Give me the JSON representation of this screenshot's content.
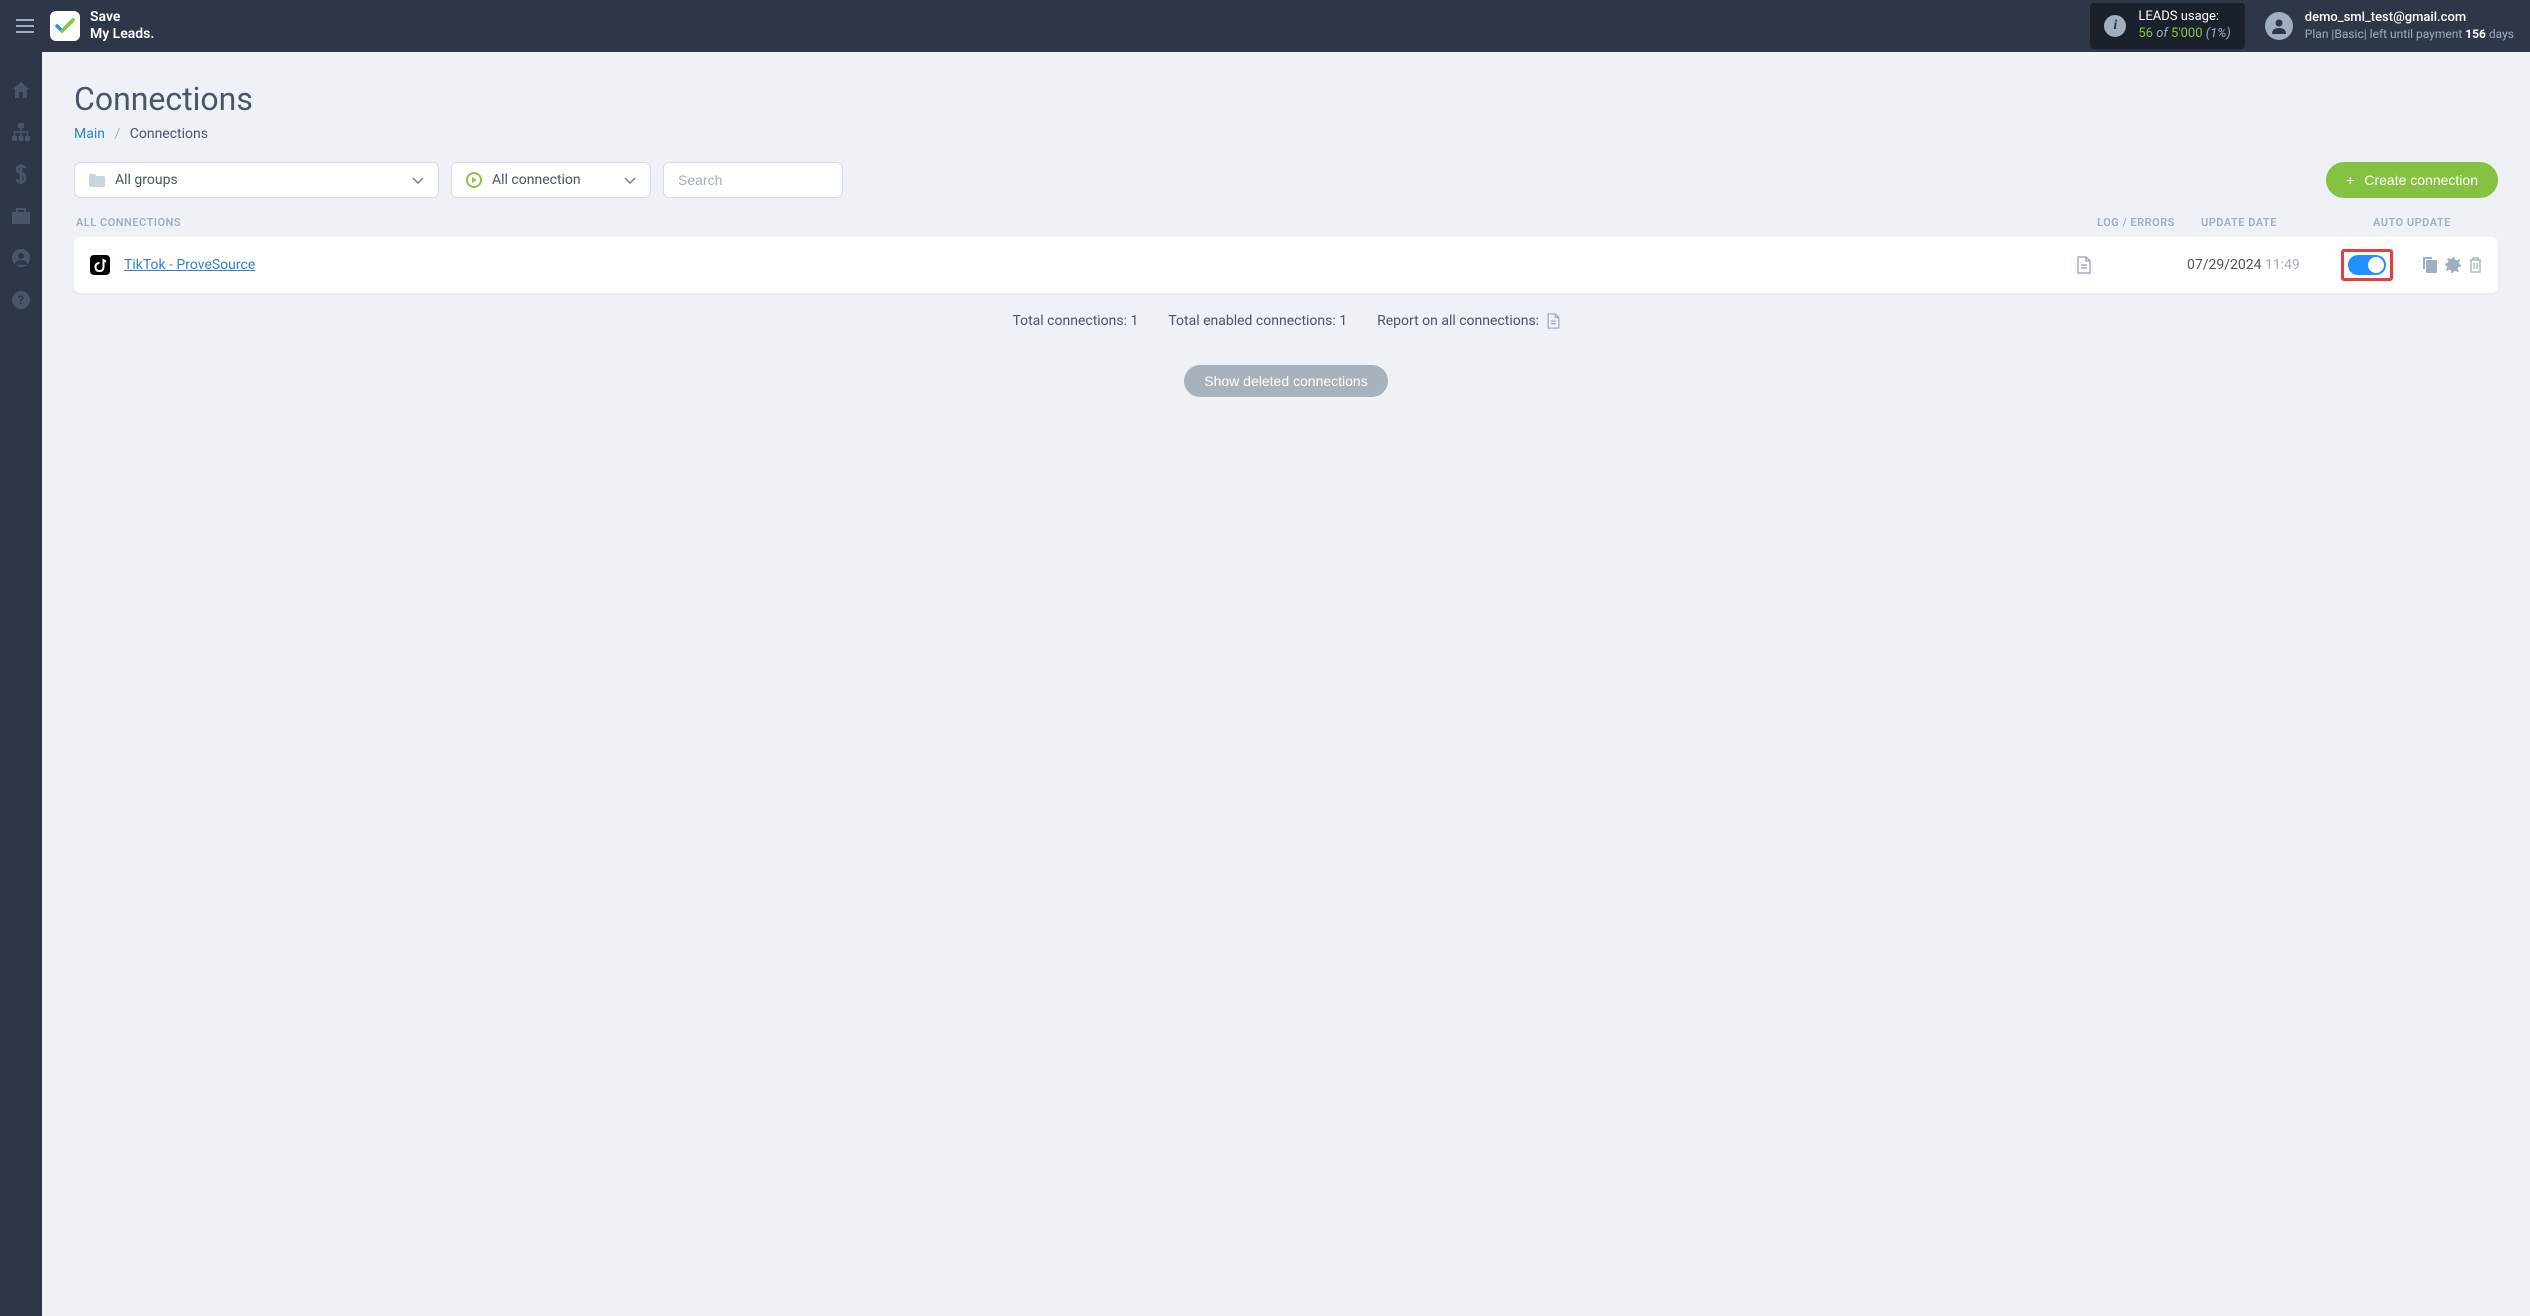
{
  "header": {
    "logo_line1": "Save",
    "logo_line2": "My Leads.",
    "leads_usage": {
      "label": "LEADS usage:",
      "used": "56",
      "of": "of",
      "total": "5'000",
      "percent": "(1%)"
    },
    "user": {
      "email": "demo_sml_test@gmail.com",
      "plan_prefix": "Plan |",
      "plan_name": "Basic",
      "plan_mid": "| left until payment ",
      "plan_days": "156",
      "plan_suffix": " days"
    }
  },
  "page": {
    "title": "Connections",
    "breadcrumb": {
      "main": "Main",
      "current": "Connections"
    }
  },
  "filters": {
    "groups_label": "All groups",
    "connection_label": "All connection",
    "search_placeholder": "Search",
    "create_button": "Create connection"
  },
  "table": {
    "headers": {
      "name": "ALL CONNECTIONS",
      "log": "LOG / ERRORS",
      "date": "UPDATE DATE",
      "auto": "AUTO UPDATE"
    },
    "rows": [
      {
        "icon": "tiktok",
        "title": "TikTok - ProveSource",
        "date": "07/29/2024",
        "time": "11:49",
        "auto_update": true
      }
    ]
  },
  "stats": {
    "total_connections": "Total connections: 1",
    "total_enabled": "Total enabled connections: 1",
    "report_label": "Report on all connections:"
  },
  "buttons": {
    "show_deleted": "Show deleted connections"
  }
}
